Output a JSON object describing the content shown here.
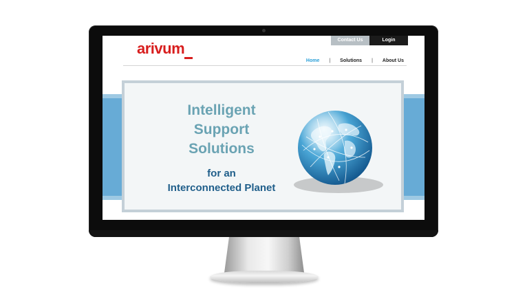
{
  "header": {
    "brand": "arivum",
    "contact_label": "Contact Us",
    "login_label": "Login"
  },
  "nav": {
    "items": [
      {
        "label": "Home",
        "active": true
      },
      {
        "label": "Solutions",
        "active": false
      },
      {
        "label": "About Us",
        "active": false
      }
    ],
    "separator": "|"
  },
  "hero": {
    "headline_1": "Intelligent",
    "headline_2": "Support",
    "headline_3": "Solutions",
    "sub_1": "for an",
    "sub_2": "Interconnected Planet"
  },
  "colors": {
    "brand": "#d81e1e",
    "active_nav": "#2a9fd8",
    "headline": "#6aa3b3",
    "subline": "#1f5e8a"
  },
  "icons": {
    "hero_image": "globe-icon"
  }
}
